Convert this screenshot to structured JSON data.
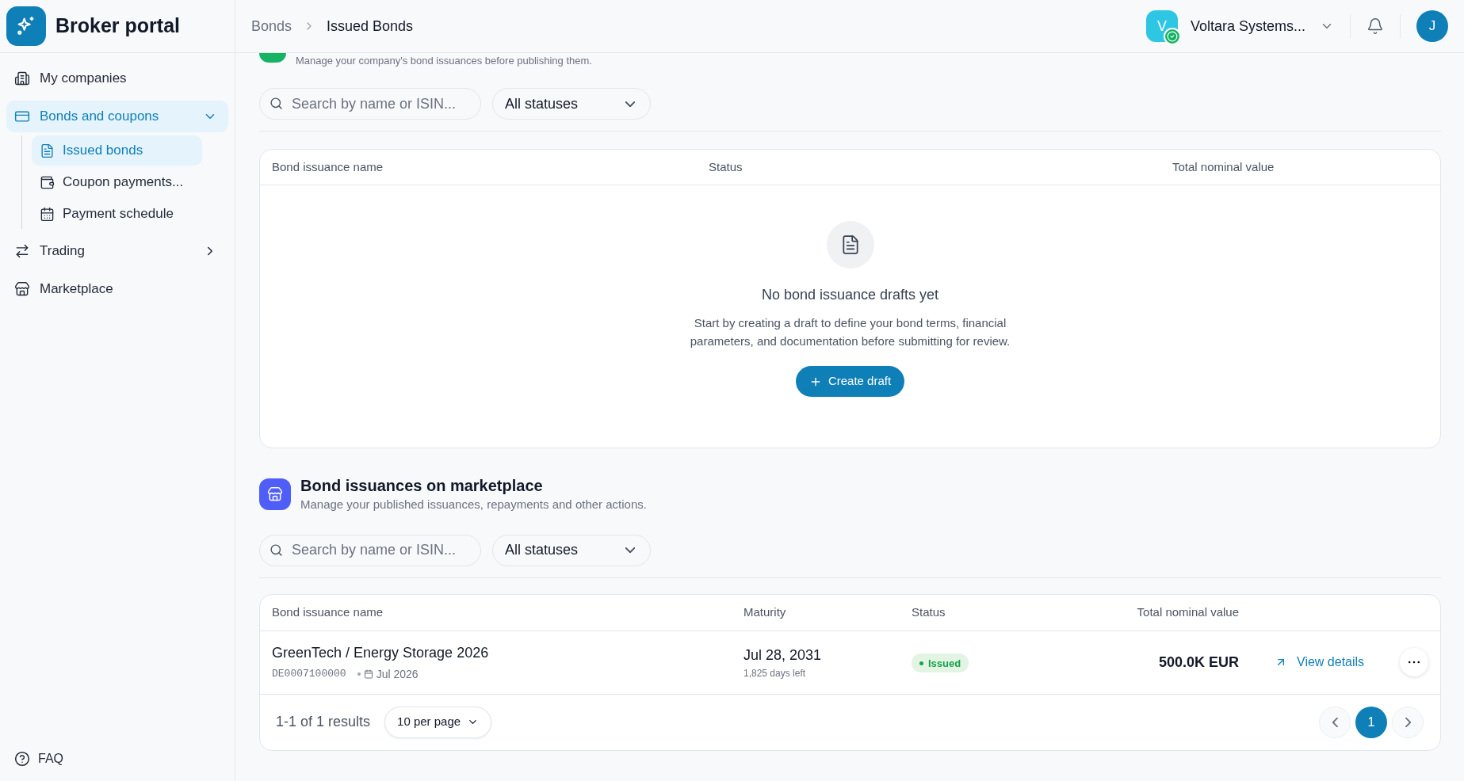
{
  "app": {
    "title": "Broker portal"
  },
  "sidebar": {
    "items": [
      {
        "label": "My companies",
        "selected": false
      },
      {
        "label": "Bonds and coupons",
        "selected": true,
        "expanded": true,
        "children": [
          {
            "label": "Issued bonds",
            "selected": true
          },
          {
            "label": "Coupon payments...",
            "selected": false
          },
          {
            "label": "Payment schedule",
            "selected": false
          }
        ]
      },
      {
        "label": "Trading",
        "selected": false,
        "expanded": false
      },
      {
        "label": "Marketplace",
        "selected": false
      }
    ],
    "footer": {
      "label": "FAQ"
    }
  },
  "breadcrumb": [
    "Bonds",
    "Issued Bonds"
  ],
  "account": {
    "initial": "V",
    "name": "Voltara Systems...",
    "verified": true
  },
  "user": {
    "initial": "J"
  },
  "drafts": {
    "subtitle": "Manage your company's bond issuances before publishing them.",
    "search": {
      "placeholder": "Search by name or ISIN..."
    },
    "filter": {
      "value": "All statuses"
    },
    "columns": [
      "Bond issuance name",
      "Status",
      "Total nominal value"
    ],
    "empty": {
      "title": "No bond issuance drafts yet",
      "description": "Start by creating a draft to define your bond terms, financial parameters, and documentation before submitting for review.",
      "button": "Create draft"
    }
  },
  "marketplace": {
    "title": "Bond issuances on marketplace",
    "subtitle": "Manage your published issuances, repayments and other actions.",
    "search": {
      "placeholder": "Search by name or ISIN..."
    },
    "filter": {
      "value": "All statuses"
    },
    "columns": [
      "Bond issuance name",
      "Maturity",
      "Status",
      "Total nominal value"
    ],
    "rows": [
      {
        "name": "GreenTech / Energy Storage 2026",
        "isin": "DE0007100000",
        "date": "Jul 2026",
        "maturity": "Jul 28, 2031",
        "days_left": "1,825 days left",
        "status": {
          "label": "Issued",
          "color": "#16a34a"
        },
        "total": "500.0K EUR",
        "action": "View details"
      }
    ],
    "pagination": {
      "summary": "1-1 of 1 results",
      "per_page": "10 per page",
      "pages": [
        {
          "label": "1",
          "selected": true
        }
      ]
    }
  }
}
